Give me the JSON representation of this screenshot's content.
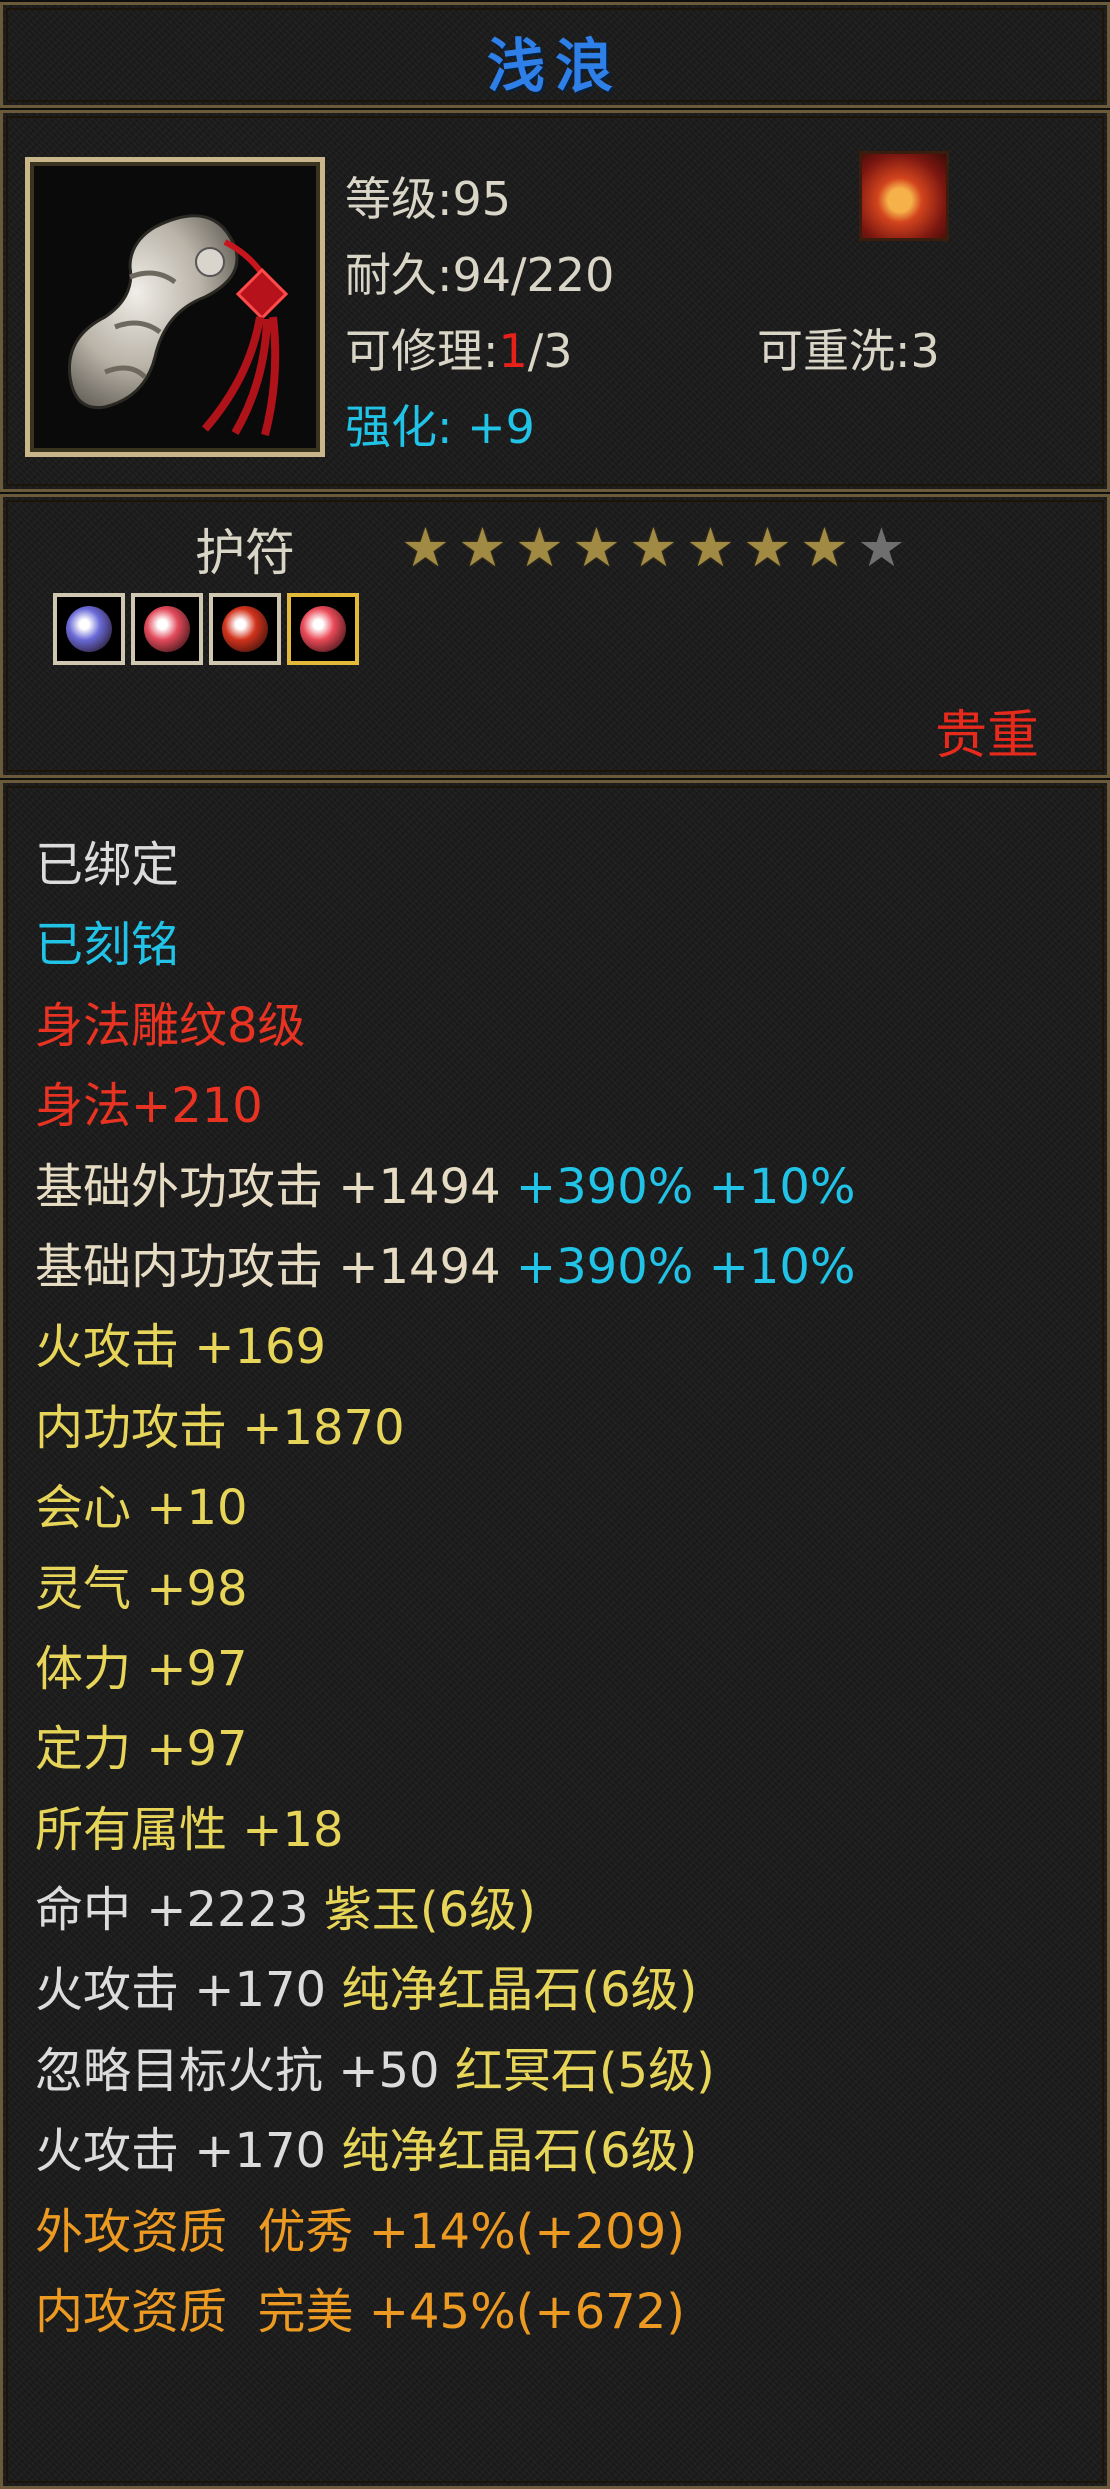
{
  "title": "浅浪",
  "info": {
    "level": "等级:95",
    "durability": "耐久:94/220",
    "repair_label": "可修理:",
    "repair_used": "1",
    "repair_total": "/3",
    "rewash": "可重洗:3",
    "enhance": "强化: +9",
    "item_icon": "jade-pendant-icon",
    "rune_icon": "flame-rune-icon"
  },
  "amulet": {
    "type": "护符",
    "stars_filled": 8,
    "stars_total": 9,
    "gems": [
      "blue-gem-icon",
      "red-gem-icon",
      "red-crystal-icon",
      "red-gem-icon"
    ],
    "gem_colors": [
      "#6a6ad8",
      "#e24a5a",
      "#d2331c",
      "#ea4a58"
    ],
    "precious": "贵重",
    "colors": {
      "star_on": "#a08a44",
      "star_off": "#6f6f6f",
      "precious": "#e82a1d"
    }
  },
  "attributes": [
    {
      "text": "已绑定",
      "color": "white"
    },
    {
      "text": "已刻铭",
      "color": "cyan"
    },
    {
      "text": "身法雕纹8级",
      "color": "red"
    },
    {
      "text": "身法+210",
      "color": "red"
    },
    {
      "text": "基础外功攻击 +1494",
      "extra": " +390% +10%",
      "color": "cream"
    },
    {
      "text": "基础内功攻击 +1494",
      "extra": " +390% +10%",
      "color": "cream"
    },
    {
      "text": "火攻击 +169",
      "color": "yellow"
    },
    {
      "text": "内功攻击 +1870",
      "color": "yellow"
    },
    {
      "text": "会心 +10",
      "color": "yellow"
    },
    {
      "text": "灵气 +98",
      "color": "yellow"
    },
    {
      "text": "体力 +97",
      "color": "yellow"
    },
    {
      "text": "定力 +97",
      "color": "yellow"
    },
    {
      "text": "所有属性 +18",
      "color": "yellow"
    },
    {
      "text": "命中 +2223",
      "extra": " 紫玉(6级)",
      "color": "white"
    },
    {
      "text": "火攻击 +170",
      "extra": " 纯净红晶石(6级)",
      "color": "white"
    },
    {
      "text": "忽略目标火抗 +50",
      "extra": " 红冥石(5级)",
      "color": "white"
    },
    {
      "text": "火攻击 +170",
      "extra": " 纯净红晶石(6级)",
      "color": "white"
    },
    {
      "text": "外攻资质  优秀 +14%(+209)",
      "color": "orange"
    },
    {
      "text": "内攻资质  完美 +45%(+672)",
      "color": "orange"
    }
  ]
}
